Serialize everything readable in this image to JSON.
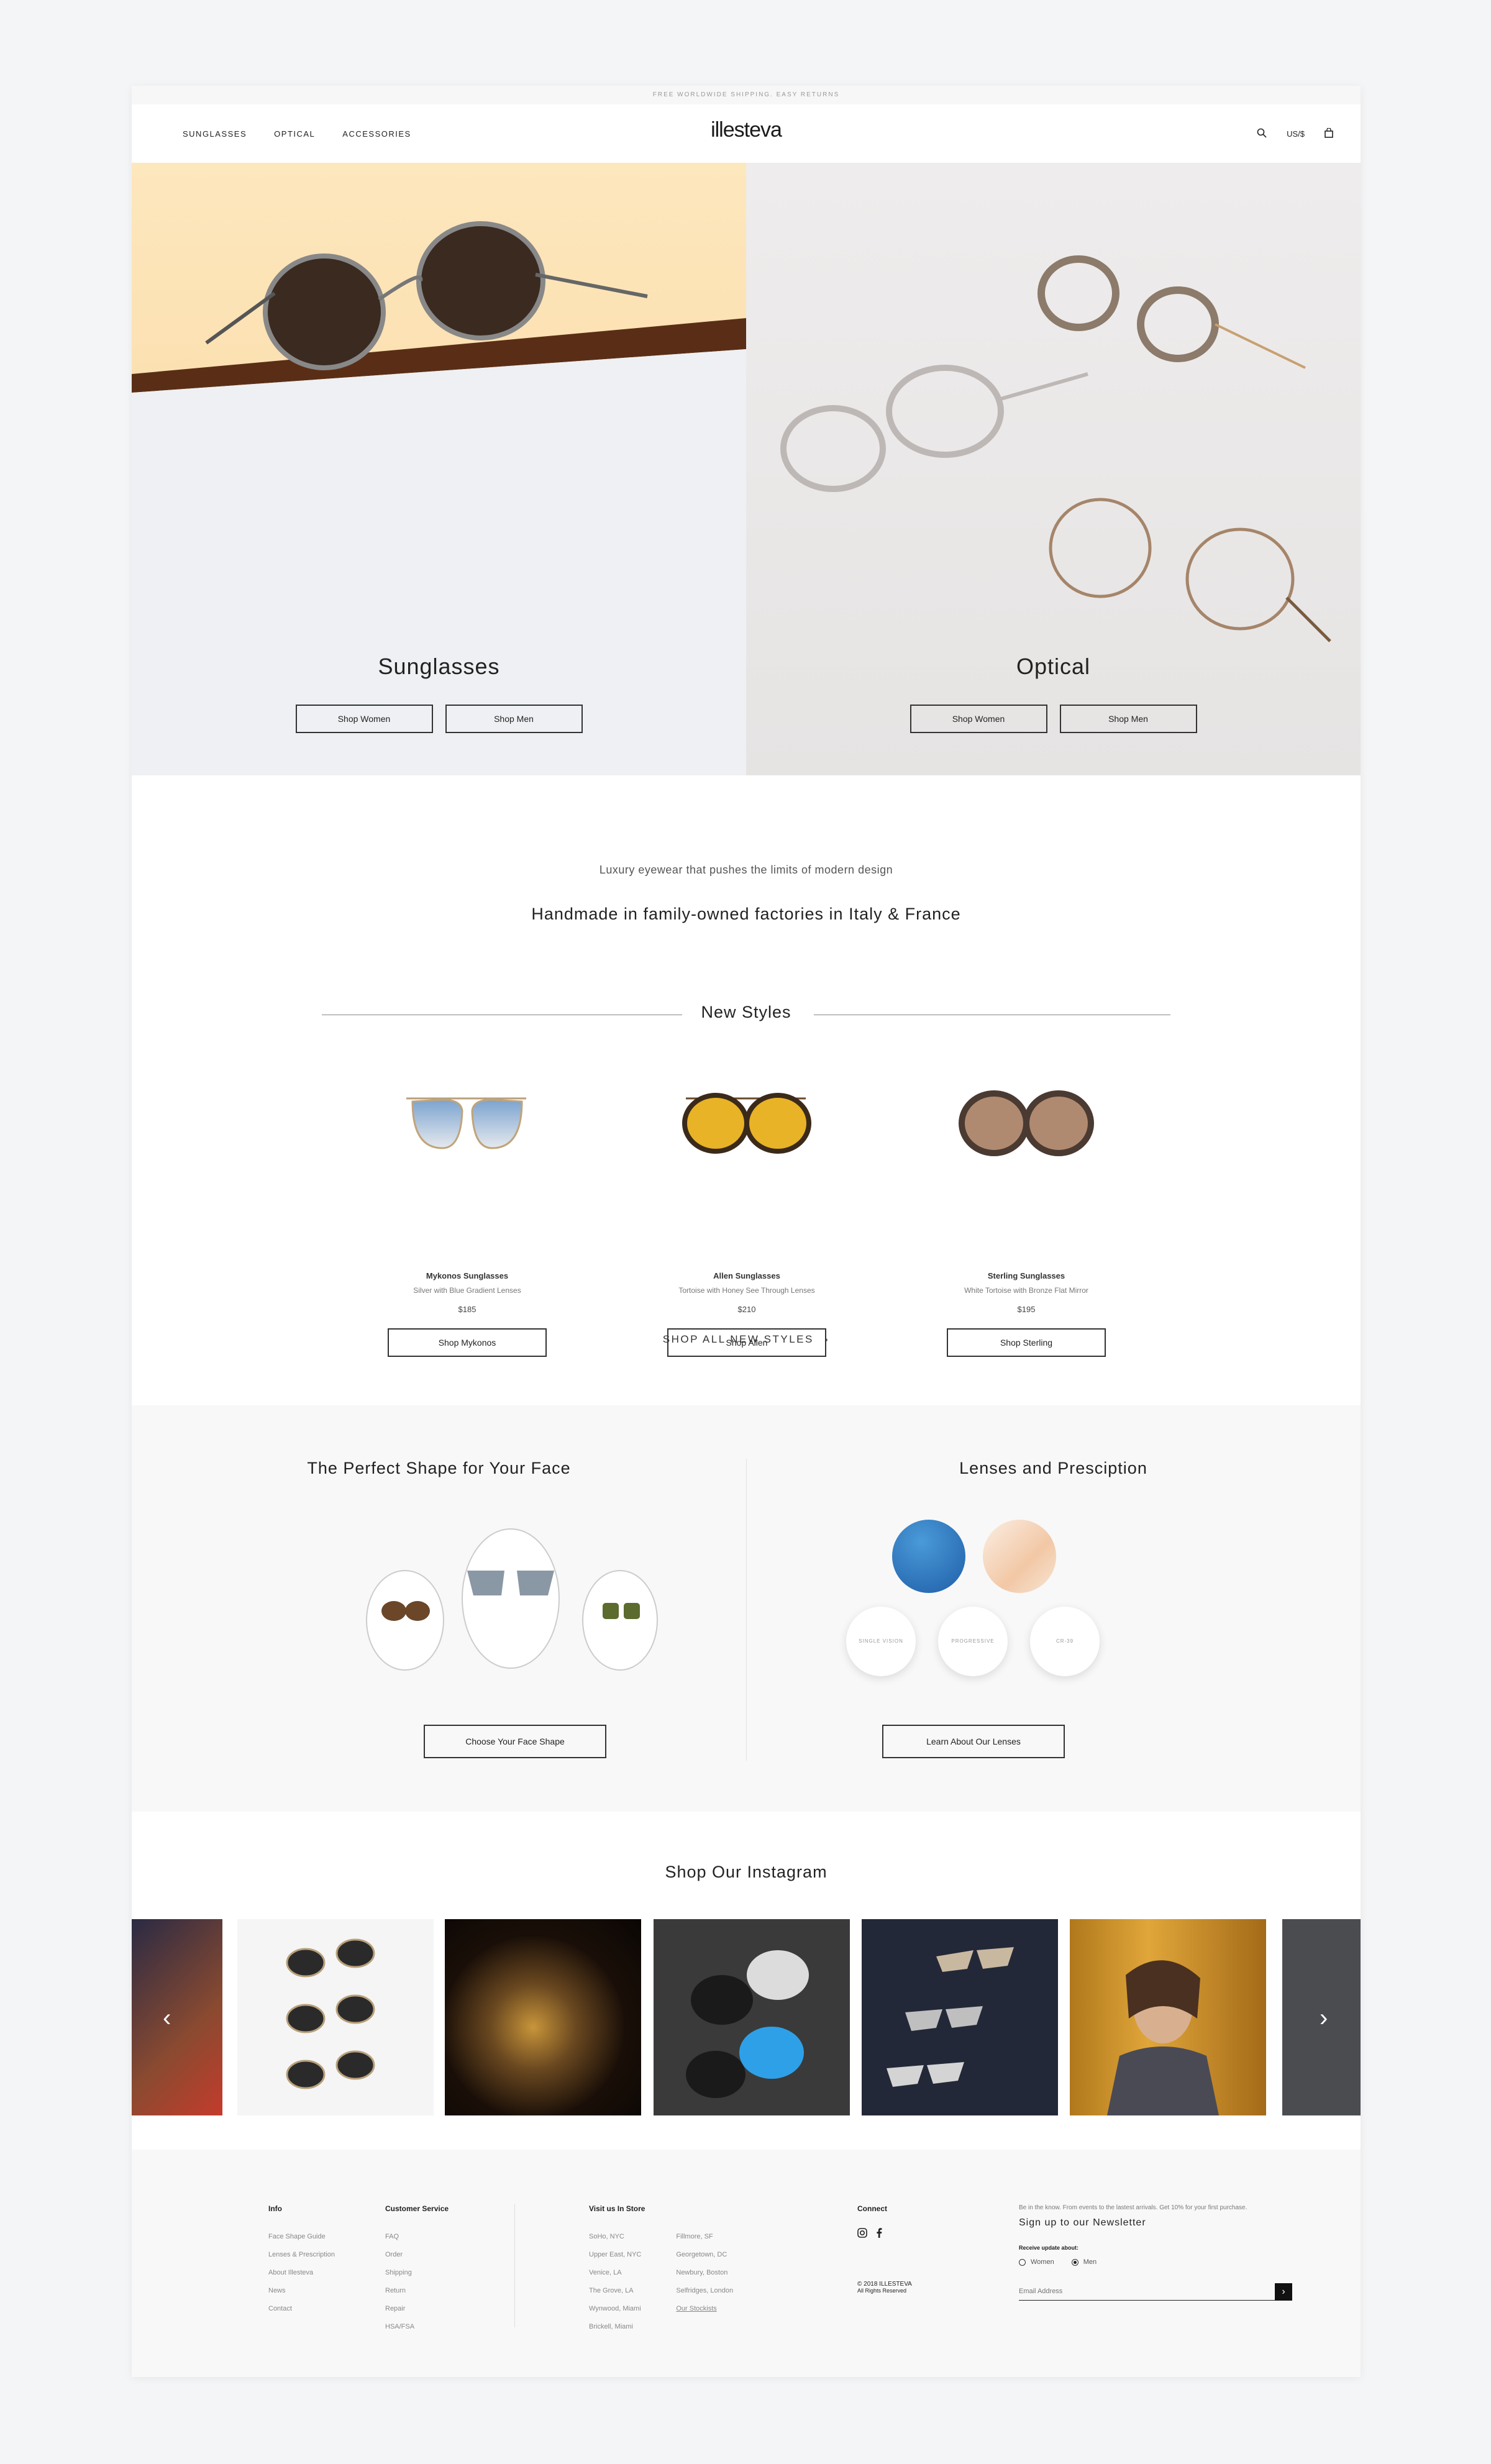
{
  "topbar": {
    "text": "FREE WORLDWIDE SHIPPING. EASY RETURNS"
  },
  "nav": {
    "links": [
      "SUNGLASSES",
      "OPTICAL",
      "ACCESSORIES"
    ],
    "logo": "illesteva",
    "currency": "US/$"
  },
  "hero": {
    "left": {
      "title": "Sunglasses",
      "btn_women": "Shop Women",
      "btn_men": "Shop Men"
    },
    "right": {
      "title": "Optical",
      "btn_women": "Shop Women",
      "btn_men": "Shop Men"
    }
  },
  "intro": {
    "tagline": "Luxury eyewear that pushes the limits of modern design",
    "headline": "Handmade in family-owned factories in Italy & France"
  },
  "new_styles": {
    "title": "New Styles",
    "products": [
      {
        "name": "Mykonos Sunglasses",
        "desc": "Silver with Blue Gradient Lenses",
        "price": "$185",
        "button": "Shop Mykonos"
      },
      {
        "name": "Allen Sunglasses",
        "desc": "Tortoise with Honey See Through Lenses",
        "price": "$210",
        "button": "Shop Allen"
      },
      {
        "name": "Sterling Sunglasses",
        "desc": "White Tortoise with Bronze Flat Mirror",
        "price": "$195",
        "button": "Shop Sterling"
      }
    ],
    "shop_all": "SHOP ALL NEW STYLES"
  },
  "face": {
    "title": "The Perfect Shape for Your Face",
    "button": "Choose Your Face Shape"
  },
  "lenses": {
    "title": "Lenses and Presciption",
    "options": [
      "SINGLE VISION",
      "PROGRESSIVE",
      "CR-39"
    ],
    "button": "Learn About Our Lenses"
  },
  "instagram": {
    "title": "Shop Our Instagram"
  },
  "footer": {
    "info": {
      "heading": "Info",
      "items": [
        "Face Shape Guide",
        "Lenses & Prescription",
        "About Illesteva",
        "News",
        "Contact"
      ]
    },
    "customer_service": {
      "heading": "Customer Service",
      "items": [
        "FAQ",
        "Order",
        "Shipping",
        "Return",
        "Repair",
        "HSA/FSA"
      ]
    },
    "stores": {
      "heading": "Visit us In Store",
      "col1": [
        "SoHo, NYC",
        "Upper East, NYC",
        "Venice, LA",
        "The Grove, LA",
        "Wynwood, Miami",
        "Brickell, Miami"
      ],
      "col2": [
        "Fillmore, SF",
        "Georgetown, DC",
        "Newbury, Boston",
        "Selfridges, London",
        "Our Stockists"
      ]
    },
    "connect": {
      "heading": "Connect",
      "copyright_1": "© 2018 ILLESTEVA",
      "copyright_2": "All Rights Reserved"
    },
    "newsletter": {
      "small": "Be in the know. From events to the lastest arrivals. Get 10% for your first purchase.",
      "title": "Sign up to our Newsletter",
      "receive": "Receive update about:",
      "opt_women": "Women",
      "opt_men": "Men",
      "placeholder": "Email Address"
    }
  }
}
